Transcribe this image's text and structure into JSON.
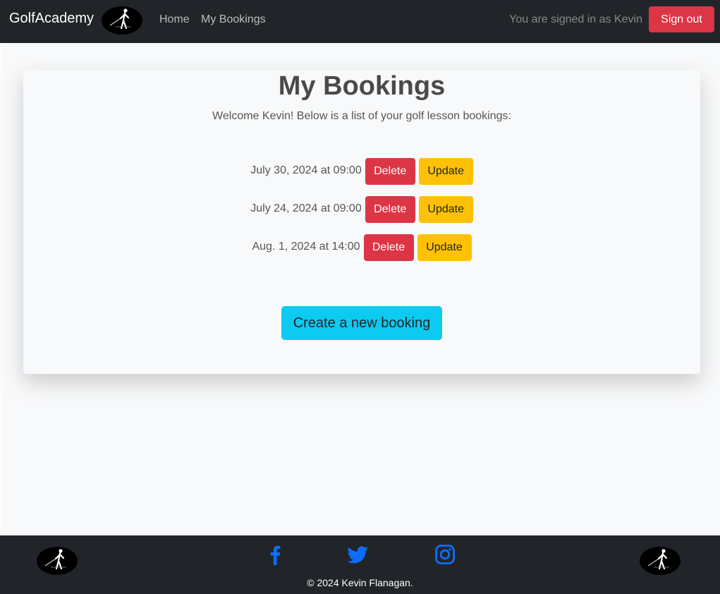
{
  "nav": {
    "brand": "GolfAcademy",
    "links": [
      "Home",
      "My Bookings"
    ],
    "signed_in_text": "You are signed in as Kevin",
    "signout_label": "Sign out"
  },
  "main": {
    "title": "My Bookings",
    "welcome": "Welcome Kevin! Below is a list of your golf lesson bookings:",
    "bookings": [
      {
        "date": "July 30, 2024 at 09:00",
        "delete_label": "Delete",
        "update_label": "Update"
      },
      {
        "date": "July 24, 2024 at 09:00",
        "delete_label": "Delete",
        "update_label": "Update"
      },
      {
        "date": "Aug. 1, 2024 at 14:00",
        "delete_label": "Delete",
        "update_label": "Update"
      }
    ],
    "create_label": "Create a new booking"
  },
  "footer": {
    "copyright": "© 2024 Kevin Flanagan.",
    "social_icons": [
      "facebook-icon",
      "twitter-icon",
      "instagram-icon"
    ]
  },
  "colors": {
    "navbar": "#212529",
    "danger": "#dc3545",
    "warning": "#ffc107",
    "info": "#0dcaf0",
    "social": "#0d6efd"
  }
}
